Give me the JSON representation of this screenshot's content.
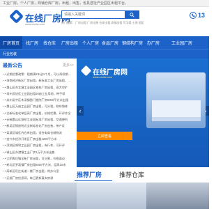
{
  "topbar": {
    "text": "工业厂房，个人厂房，商铺仓库厂房，出租，出售，省县选址产业园区出租平台。"
  },
  "logo": {
    "name": "在线厂房网",
    "domain": "www.zxcfw.com"
  },
  "search": {
    "placeholder": "请输入关键词",
    "button_icon": "search-icon"
  },
  "hotwords": "热门搜索：厂房出租  厂房出售  仓库出租  商铺出租  写字楼  土地  园区",
  "phone": {
    "number": "13",
    "icon": "phone-icon"
  },
  "nav": [
    {
      "label": "厂房首页"
    },
    {
      "label": "找厂房"
    },
    {
      "label": "找仓库"
    },
    {
      "label": "厂房出租"
    },
    {
      "label": "个人厂房"
    },
    {
      "label": "食品厂房"
    },
    {
      "label": "钢结构厂房"
    },
    {
      "label": "办厂房"
    },
    {
      "label": "工业园厂房"
    }
  ],
  "catbar": {
    "label": "行业包装"
  },
  "news": {
    "title": "最新公告",
    "more": "更多>>",
    "items": [
      "• 近期优惠政策：租期满2年送1个月，可以再续期优惠",
      "• 海南经济新区厂房出租，新标准工业厂房出租，价格优惠",
      "• 惠山区东北塘工业园区独栋厂房出租，高大空旷",
      "• 常州武进区工业园出租20亩工业用地，带手续",
      "• 苏州吴中区木渎镇独门独院厂房6000平方米出租",
      "• 惠山区万亩工业园厂房出租，可分租，联排独栋",
      "• 全新标准化单层高厂房出租，价格优惠，环评齐全",
      "• 无锡惠山区堰桥工业园标准厂房出租，交通便利",
      "• 新吴区硕放附近全新标准化厂房出售，带产证",
      "• 梁溪区城区内仓库出租，适合电商仓储物流",
      "• 宜兴市经济开发区厂房出租1200平方米",
      "• 滨湖区胡埭工业园厂房出租，有行车，可环评",
      "• 锡山区东港镇工业厂房1万平方米出售",
      "• 江阴周庄镇全新厂房出租，可分割，价格面议",
      "• 新北区罗溪镇厂房出租5000平方米，层高10米",
      "• 高新区旺庄街道一楼厂房出租，带办公室",
      "• 无锡厂房信息网，每日更新真实房源",
      "• 武进经开区钢结构厂房出租，配电充足",
      "• 惠山区独栋厂房出售，可按揭，带产证"
    ]
  },
  "banner": {
    "brand": "在线厂房网",
    "domain": "www.zxcfw.com",
    "cta": "立即查看",
    "prev": "‹",
    "next": "›"
  },
  "tabs": [
    {
      "label": "推荐厂房"
    },
    {
      "label": "推荐仓库"
    }
  ]
}
